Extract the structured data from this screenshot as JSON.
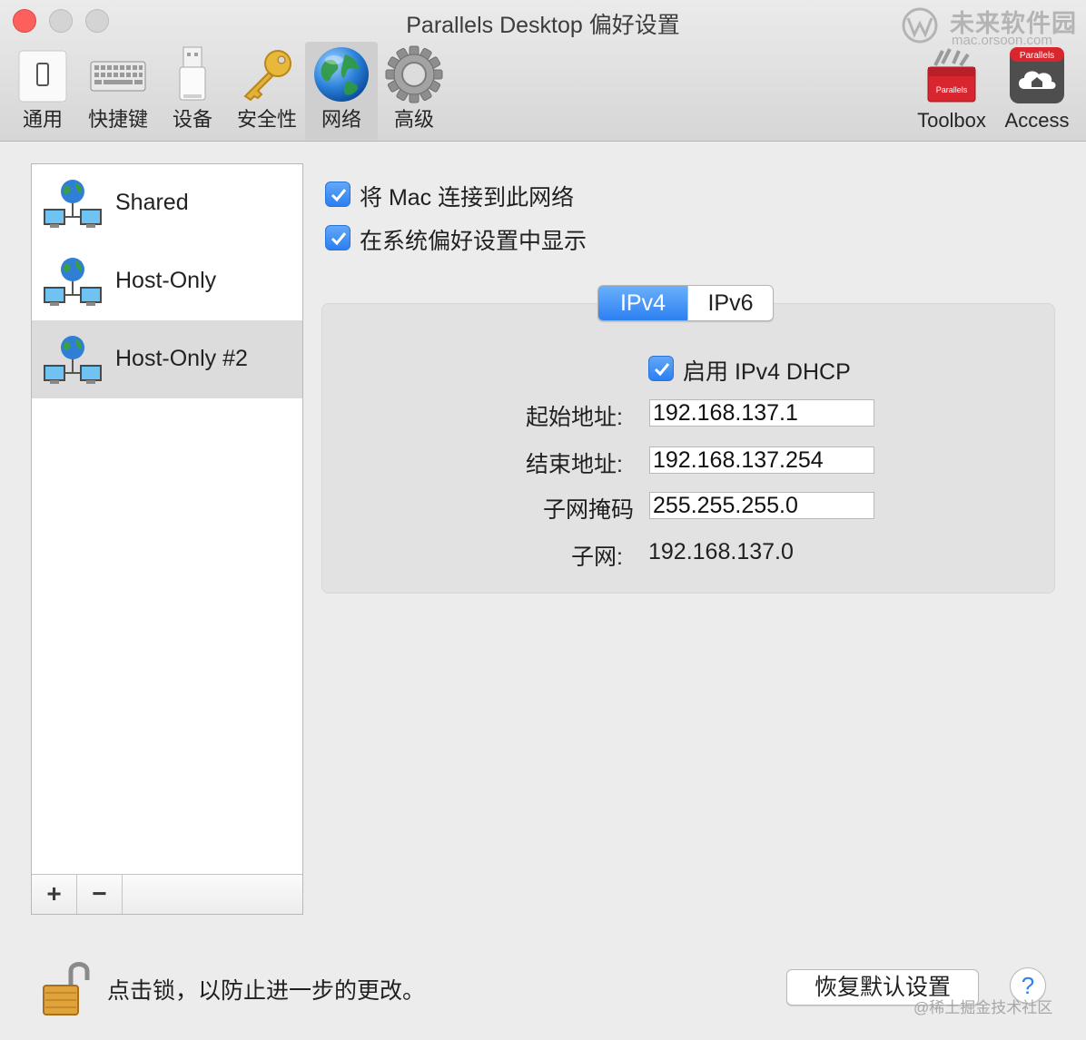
{
  "window": {
    "title": "Parallels Desktop 偏好设置"
  },
  "toolbar": {
    "items": [
      {
        "label": "通用",
        "icon": "general-switch-icon"
      },
      {
        "label": "快捷键",
        "icon": "keyboard-icon"
      },
      {
        "label": "设备",
        "icon": "usb-device-icon"
      },
      {
        "label": "安全性",
        "icon": "key-icon"
      },
      {
        "label": "网络",
        "icon": "globe-icon",
        "selected": true
      },
      {
        "label": "高级",
        "icon": "gear-icon"
      }
    ],
    "right_items": [
      {
        "label": "Toolbox",
        "icon": "toolbox-icon",
        "badge": "Parallels"
      },
      {
        "label": "Access",
        "icon": "access-icon",
        "badge": "Parallels"
      }
    ]
  },
  "watermark": {
    "line1": "未来软件园",
    "line2": "mac.orsoon.com"
  },
  "networks": {
    "items": [
      {
        "label": "Shared"
      },
      {
        "label": "Host-Only"
      },
      {
        "label": "Host-Only #2",
        "selected": true
      }
    ],
    "add_label": "+",
    "remove_label": "−"
  },
  "options": {
    "connect_mac": {
      "label": "将 Mac 连接到此网络",
      "checked": true
    },
    "show_in_prefs": {
      "label": "在系统偏好设置中显示",
      "checked": true
    }
  },
  "tabs": {
    "ipv4": "IPv4",
    "ipv6": "IPv6",
    "active": "IPv4"
  },
  "ipv4": {
    "dhcp": {
      "label": "启用 IPv4 DHCP",
      "checked": true
    },
    "start_label": "起始地址:",
    "start_value": "192.168.137.1",
    "end_label": "结束地址:",
    "end_value": "192.168.137.254",
    "mask_label": "子网掩码",
    "mask_value": "255.255.255.0",
    "subnet_label": "子网:",
    "subnet_value": "192.168.137.0"
  },
  "footer": {
    "lock_text": "点击锁，以防止进一步的更改。",
    "restore_label": "恢复默认设置",
    "help_label": "?",
    "credit": "@稀土掘金技术社区"
  },
  "colors": {
    "accent": "#2d80f2",
    "close": "#fc605c",
    "brand_red": "#d7262e"
  }
}
